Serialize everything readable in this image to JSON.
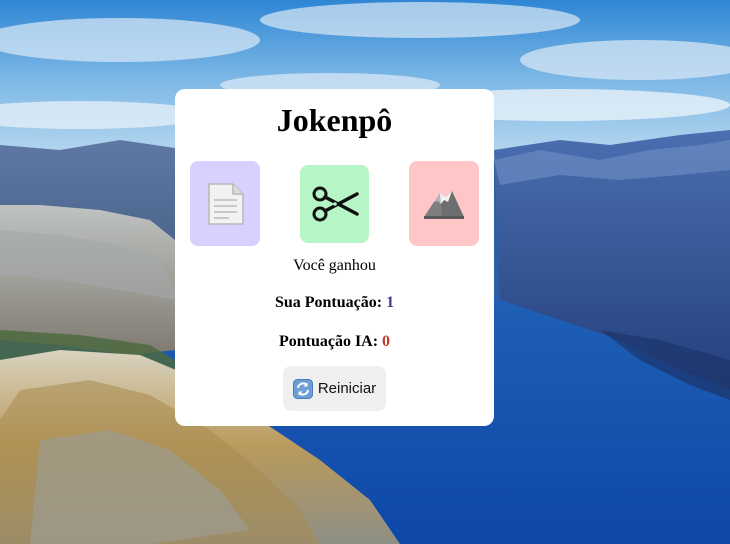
{
  "game": {
    "title": "Jokenpô",
    "choices": [
      {
        "name": "paper",
        "icon": "paper-document-icon",
        "color": "#d7d1ff"
      },
      {
        "name": "scissors",
        "icon": "scissors-icon",
        "color": "#b6f5c6"
      },
      {
        "name": "rock",
        "icon": "mountain-icon",
        "color": "#ffc6c8"
      }
    ],
    "result_text": "Você ganhou",
    "player_score_label": "Sua Pontuação:",
    "player_score": "1",
    "ai_score_label": "Pontuação IA:",
    "ai_score": "0",
    "restart_label": "Reiniciar",
    "restart_icon": "refresh-icon"
  },
  "colors": {
    "card_bg": "#ffffff",
    "player_score": "#3b3b8f",
    "ai_score": "#c0392b",
    "button_bg": "#efefef"
  }
}
